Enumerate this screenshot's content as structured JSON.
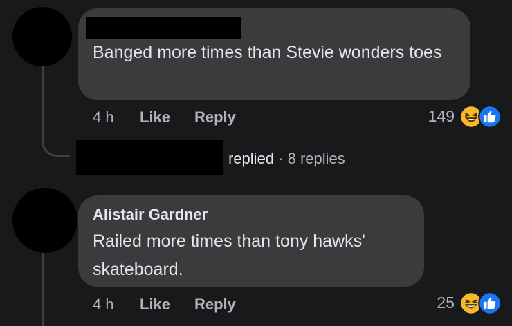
{
  "comments": [
    {
      "author": "",
      "text": "Banged more times than Stevie wonders toes",
      "time": "4 h",
      "like_label": "Like",
      "reply_label": "Reply",
      "reaction_count": "149",
      "reactions": [
        "haha-icon",
        "like-icon"
      ],
      "replies": {
        "replied_word": "replied",
        "separator": "·",
        "count_text": "8 replies"
      }
    },
    {
      "author": "Alistair Gardner",
      "text": "Railed more times than tony hawks' skateboard.",
      "time": "4 h",
      "like_label": "Like",
      "reply_label": "Reply",
      "reaction_count": "25",
      "reactions": [
        "haha-icon",
        "like-icon"
      ]
    }
  ],
  "colors": {
    "background": "#18191a",
    "bubble": "#3a3b3c",
    "text_primary": "#e4e6eb",
    "text_secondary": "#b0b3b8",
    "like_blue": "#1877f2",
    "haha_yellow": "#f7b928"
  }
}
